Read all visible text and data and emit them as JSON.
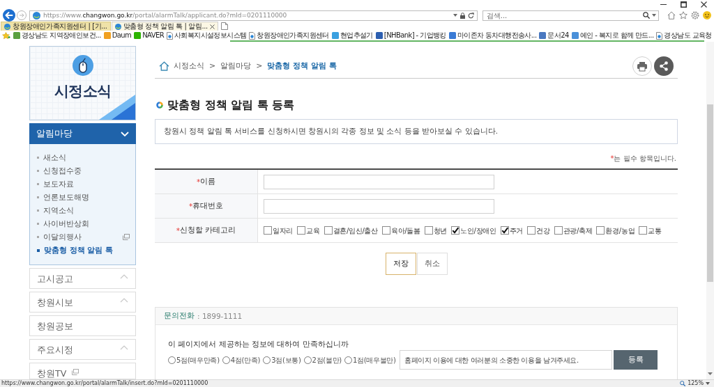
{
  "browser": {
    "url": {
      "prefix": "https://www.",
      "domain": "changwon.go.kr",
      "path": "/portal/alarmTalk/applicant.do?mId=0201110000"
    },
    "search": {
      "placeholder": "검색..."
    },
    "tabs": [
      {
        "title": "창원장애인가족지원센터 | [기...",
        "selected": false
      },
      {
        "title": "맞춤형 정책 알림 톡 | 알림...",
        "selected": true
      }
    ],
    "favorites": [
      {
        "label": "경상남도 지역장애인보건...",
        "kind": "tile",
        "color": "#5aa040"
      },
      {
        "label": "Daum",
        "kind": "tile",
        "color": "#f0a020"
      },
      {
        "label": "NAVER",
        "kind": "tile",
        "color": "#2db400"
      },
      {
        "label": "사회복지시설정보시스템",
        "kind": "page"
      },
      {
        "label": "창원장애인가족지원센터",
        "kind": "page"
      },
      {
        "label": "현업추설기",
        "kind": "tile",
        "color": "#3aa0e0"
      },
      {
        "label": "[NHBank] - 기업뱅킹",
        "kind": "tile",
        "color": "#2d5fb0"
      },
      {
        "label": "마이존차 동차대행전송사...",
        "kind": "tile",
        "color": "#3a7bd5"
      },
      {
        "label": "문서24",
        "kind": "tile",
        "color": "#4a78c0"
      },
      {
        "label": "예인 - 복지로 함께 만드...",
        "kind": "tile",
        "color": "#4a90d9"
      },
      {
        "label": "경상남도 교육청",
        "kind": "page"
      }
    ]
  },
  "sidebar": {
    "title": "시정소식",
    "menus": [
      {
        "label": "알림마당",
        "kind": "group",
        "expanded": true,
        "children": [
          {
            "label": "새소식",
            "selected": false,
            "external": false
          },
          {
            "label": "신청접수중",
            "selected": false,
            "external": false
          },
          {
            "label": "보도자료",
            "selected": false,
            "external": false
          },
          {
            "label": "언론보도해명",
            "selected": false,
            "external": false
          },
          {
            "label": "지역소식",
            "selected": false,
            "external": false
          },
          {
            "label": "사이버반상회",
            "selected": false,
            "external": false
          },
          {
            "label": "이달의행사",
            "selected": false,
            "external": true
          },
          {
            "label": "맞춤형 정책 알림 톡",
            "selected": true,
            "external": false
          }
        ]
      },
      {
        "label": "고시공고",
        "kind": "group",
        "expanded": false
      },
      {
        "label": "창원시보",
        "kind": "group",
        "expanded": false
      },
      {
        "label": "창원공보",
        "kind": "link",
        "expanded": false
      },
      {
        "label": "주요시정",
        "kind": "group",
        "expanded": false
      },
      {
        "label": "창원TV",
        "kind": "external",
        "expanded": false
      }
    ]
  },
  "breadcrumb": {
    "separator": ">",
    "items": [
      {
        "label": "시정소식",
        "current": false
      },
      {
        "label": "알림마당",
        "current": false
      },
      {
        "label": "맞춤형 정책 알림 톡",
        "current": true
      }
    ]
  },
  "page_title": "맞춤형 정책 알림 톡 등록",
  "intro": "창원시 정책 알림 톡 서비스를 신청하시면 창원시의 각종 정보 및 소식 등을 받아보실 수 있습니다.",
  "form": {
    "required_mark": "*",
    "required_note": "는 필수 항목입니다.",
    "fields": [
      {
        "kind": "text",
        "label": "이름",
        "required": true
      },
      {
        "kind": "text",
        "label": "휴대번호",
        "required": true
      },
      {
        "kind": "checkboxes",
        "label": "신청할 카테고리",
        "required": true,
        "options": [
          {
            "label": "일자리",
            "checked": false
          },
          {
            "label": "교육",
            "checked": false
          },
          {
            "label": "결혼/임신/출산",
            "checked": false
          },
          {
            "label": "육아/돌봄",
            "checked": false
          },
          {
            "label": "청년",
            "checked": false
          },
          {
            "label": "노인/장애인",
            "checked": true
          },
          {
            "label": "주거",
            "checked": true
          },
          {
            "label": "건강",
            "checked": false
          },
          {
            "label": "관광/축제",
            "checked": false
          },
          {
            "label": "환경/농업",
            "checked": false
          },
          {
            "label": "교통",
            "checked": false
          }
        ]
      }
    ],
    "buttons": [
      {
        "label": "저장",
        "primary": true
      },
      {
        "label": "취소",
        "primary": false
      }
    ]
  },
  "feedback": {
    "contact_label": "문의전화",
    "contact_value": ": 1899-1111",
    "question": "이 페이지에서 제공하는 정보에 대하여 만족하십니까",
    "ratings": [
      {
        "label": "5점(매우만족)",
        "selected": false
      },
      {
        "label": "4점(만족)",
        "selected": false
      },
      {
        "label": "3점(보통)",
        "selected": false
      },
      {
        "label": "2점(불만)",
        "selected": false
      },
      {
        "label": "1점(매우불만)",
        "selected": false
      }
    ],
    "comment": {
      "placeholder": "홈페이지 이용에 대한 여러분의 소중한 이용을 남겨주세요."
    },
    "submit": "등록"
  },
  "status_bar": {
    "url": "https://www.changwon.go.kr/portal/alarmTalk/insert.do?mId=0201110000",
    "zoom": "125%"
  }
}
